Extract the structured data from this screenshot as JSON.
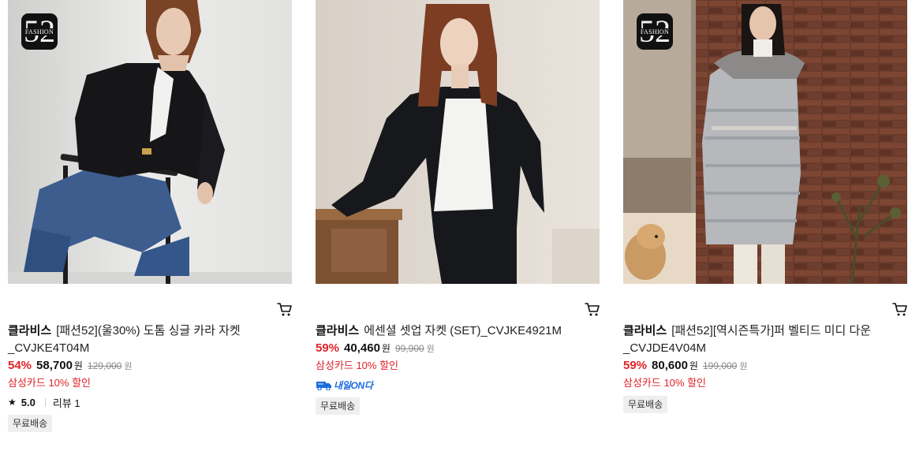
{
  "products": [
    {
      "fashion52_badge": "FASHION",
      "fashion52_number": "52",
      "brand": "클라비스",
      "name": "[패션52](울30%) 도톰 싱글 카라 자켓 _CVJKE4T04M",
      "discount_rate": "54%",
      "price": "58,700",
      "price_unit": "원",
      "original_price": "129,000",
      "original_unit": "원",
      "card_discount": "삼성카드 10% 할인",
      "rating": "5.0",
      "review_label": "리뷰 1",
      "shipping_badge": "무료배송",
      "cart_icon": "cart-icon"
    },
    {
      "brand": "클라비스",
      "name": "에센셜 셋업 자켓 (SET)_CVJKE4921M",
      "discount_rate": "59%",
      "price": "40,460",
      "price_unit": "원",
      "original_price": "99,900",
      "original_unit": "원",
      "card_discount": "삼성카드 10% 할인",
      "delivery_tag": "내일ON다",
      "shipping_badge": "무료배송",
      "cart_icon": "cart-icon"
    },
    {
      "fashion52_badge": "FASHION",
      "fashion52_number": "52",
      "brand": "클라비스",
      "name": "[패션52][역시즌특가]퍼 벨티드 미디 다운 _CVJDE4V04M",
      "discount_rate": "59%",
      "price": "80,600",
      "price_unit": "원",
      "original_price": "199,000",
      "original_unit": "원",
      "card_discount": "삼성카드 10% 할인",
      "shipping_badge": "무료배송",
      "cart_icon": "cart-icon"
    }
  ],
  "colors": {
    "discount_red": "#e0232a",
    "delivery_blue": "#1b6be0",
    "badge_bg": "#efefef"
  }
}
